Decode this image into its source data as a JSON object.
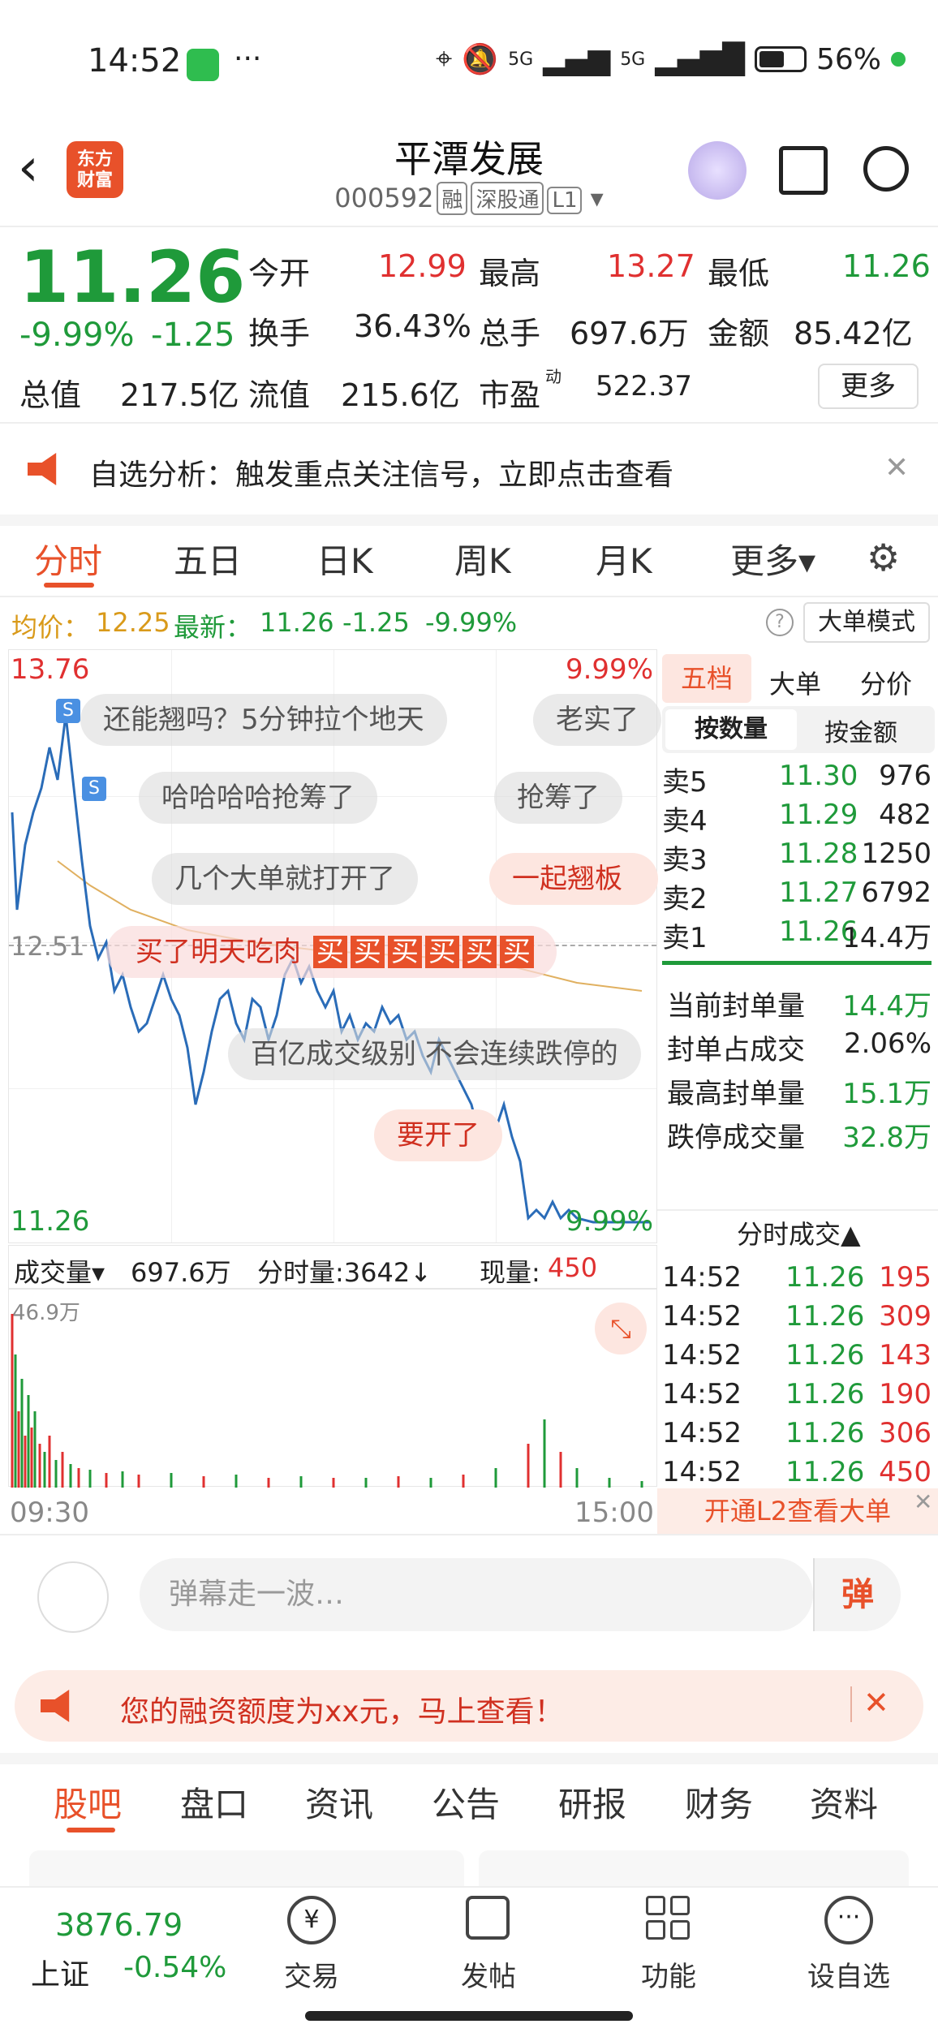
{
  "status": {
    "time": "14:52",
    "dots": "···",
    "battery": "56%",
    "net1": "5G",
    "net2": "5G"
  },
  "header": {
    "back": "‹",
    "logo_line1": "东方",
    "logo_line2": "财富",
    "title": "平潭发展",
    "code": "000592",
    "tags": [
      "融",
      "深股通",
      "L1"
    ]
  },
  "quote": {
    "price": "11.26",
    "chg_pct": "-9.99%",
    "chg": "-1.25",
    "open_label": "今开",
    "open": "12.99",
    "high_label": "最高",
    "high": "13.27",
    "low_label": "最低",
    "low": "11.26",
    "turnover_label": "换手",
    "turnover": "36.43%",
    "vol_label": "总手",
    "vol": "697.6万",
    "amount_label": "金额",
    "amount": "85.42亿",
    "mcap_label": "总值",
    "mcap": "217.5亿",
    "float_label": "流值",
    "float": "215.6亿",
    "pe_label": "市盈",
    "pe_sup": "动",
    "pe": "522.37",
    "more": "更多"
  },
  "notice": {
    "text": "自选分析：触发重点关注信号，立即点击查看",
    "close": "✕"
  },
  "tabs": [
    "分时",
    "五日",
    "日K",
    "周K",
    "月K",
    "更多▾"
  ],
  "infobar": {
    "avg_label": "均价：",
    "avg": "12.25",
    "latest_label": "最新：",
    "latest": "11.26",
    "chg": "-1.25",
    "pct": "-9.99%",
    "help": "?",
    "mode": "大单模式"
  },
  "chart": {
    "ymax": "13.76",
    "ymax_pct": "9.99%",
    "ymid": "12.51",
    "ymin": "11.26",
    "ymin_pct": "9.99%",
    "s1": "S",
    "s2": "S"
  },
  "danmu": [
    "还能翘吗？5分钟拉个地天",
    "老实了",
    "哈哈哈哈抢筹了",
    "抢筹了",
    "几个大单就打开了",
    "一起翘板",
    "买了明天吃肉",
    "买",
    "百亿成交级别 不会连续跌停的",
    "要开了"
  ],
  "volbar": {
    "label": "成交量",
    "total": "697.6万",
    "tick_label": "分时量:3642↓",
    "now_label": "现量:",
    "now": "450",
    "max": "46.9万",
    "start": "09:30",
    "end": "15:00"
  },
  "orderbook": {
    "tabs": [
      "五档",
      "大单",
      "分价"
    ],
    "subtabs": [
      "按数量",
      "按金额"
    ],
    "asks": [
      {
        "label": "卖5",
        "price": "11.30",
        "qty": "976"
      },
      {
        "label": "卖4",
        "price": "11.29",
        "qty": "482"
      },
      {
        "label": "卖3",
        "price": "11.28",
        "qty": "1250"
      },
      {
        "label": "卖2",
        "price": "11.27",
        "qty": "6792"
      },
      {
        "label": "卖1",
        "price": "11.26",
        "qty": "14.4万"
      }
    ],
    "stats": [
      {
        "label": "当前封单量",
        "value": "14.4万"
      },
      {
        "label": "封单占成交",
        "value": "2.06%"
      },
      {
        "label": "最高封单量",
        "value": "15.1万"
      },
      {
        "label": "跌停成交量",
        "value": "32.8万"
      }
    ],
    "trades_title": "分时成交▲",
    "trades": [
      {
        "t": "14:52",
        "p": "11.26",
        "v": "195"
      },
      {
        "t": "14:52",
        "p": "11.26",
        "v": "309"
      },
      {
        "t": "14:52",
        "p": "11.26",
        "v": "143"
      },
      {
        "t": "14:52",
        "p": "11.26",
        "v": "190"
      },
      {
        "t": "14:52",
        "p": "11.26",
        "v": "306"
      },
      {
        "t": "14:52",
        "p": "11.26",
        "v": "450"
      }
    ],
    "l2": "开通L2查看大单"
  },
  "danmu_input": {
    "placeholder": "弹幕走一波…",
    "btn": "弹"
  },
  "promo": {
    "text": "您的融资额度为xx元，马上查看！"
  },
  "btabs": [
    "股吧",
    "盘口",
    "资讯",
    "公告",
    "研报",
    "财务",
    "资料"
  ],
  "bottom": {
    "index": "3876.79",
    "index_name": "上证",
    "index_chg": "-0.54%",
    "items": [
      "交易",
      "发帖",
      "功能",
      "设自选"
    ]
  }
}
